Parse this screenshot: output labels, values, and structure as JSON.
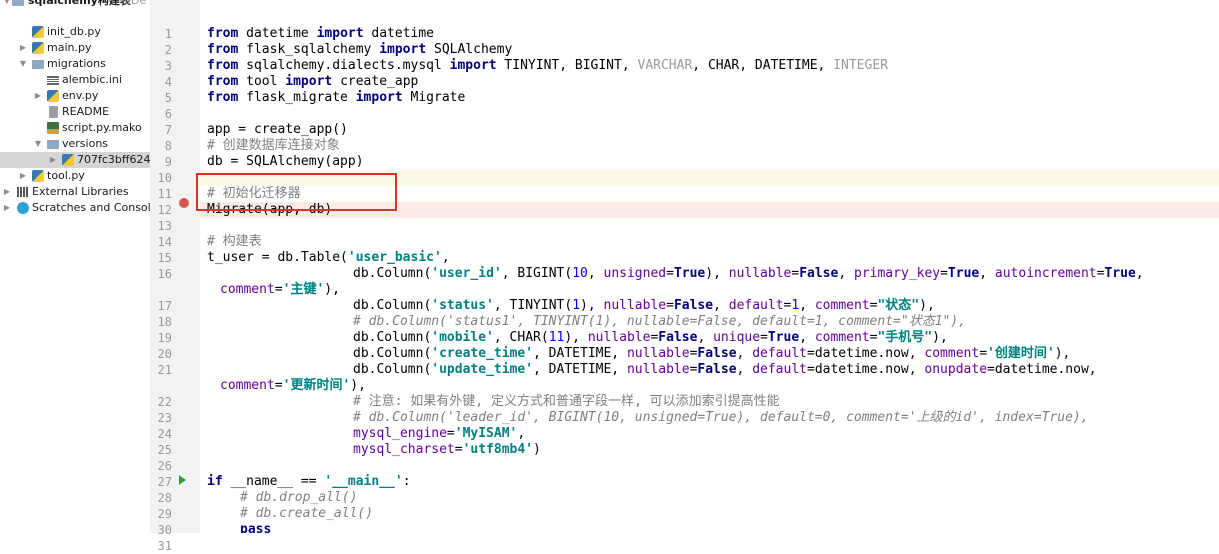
{
  "tree": {
    "project_partial": "sqlalchemy构建表",
    "project_path_partial": "~/De",
    "items": [
      {
        "label": "init_db.py",
        "icon": "python-file-icon"
      },
      {
        "label": "main.py",
        "icon": "python-file-icon"
      },
      {
        "label": "migrations",
        "icon": "folder-icon"
      },
      {
        "label": "alembic.ini",
        "icon": "ini-file-icon"
      },
      {
        "label": "env.py",
        "icon": "python-file-icon"
      },
      {
        "label": "README",
        "icon": "text-file-icon"
      },
      {
        "label": "script.py.mako",
        "icon": "mako-file-icon"
      },
      {
        "label": "versions",
        "icon": "folder-icon"
      },
      {
        "label": "707fc3bff624_",
        "icon": "python-file-icon"
      },
      {
        "label": "tool.py",
        "icon": "python-file-icon"
      },
      {
        "label": "External Libraries",
        "icon": "library-icon"
      },
      {
        "label": "Scratches and Consoles",
        "icon": "scratch-icon"
      }
    ]
  },
  "editor": {
    "line_numbers": [
      "1",
      "2",
      "3",
      "4",
      "5",
      "6",
      "7",
      "8",
      "9",
      "10",
      "11",
      "12",
      "13",
      "14",
      "15",
      "16",
      "17",
      "18",
      "19",
      "20",
      "21",
      "22",
      "23",
      "24",
      "25",
      "26",
      "27",
      "28",
      "29",
      "30",
      "31"
    ],
    "code": {
      "l1": [
        "from",
        " datetime ",
        "import",
        " datetime"
      ],
      "l2": [
        "from",
        " flask_sqlalchemy ",
        "import",
        " SQLAlchemy"
      ],
      "l3": [
        "from",
        " sqlalchemy.dialects.mysql ",
        "import",
        " TINYINT, BIGINT, ",
        "VARCHAR",
        ", CHAR, DATETIME, ",
        "INTEGER"
      ],
      "l4": [
        "from",
        " tool ",
        "import",
        " create_app"
      ],
      "l5": [
        "from",
        " flask_migrate ",
        "import",
        " Migrate"
      ],
      "l7": "app = create_app()",
      "l8": "# 创建数据库连接对象",
      "l9": "db = SQLAlchemy(app)",
      "l11": "# 初始化迁移器",
      "l12": "Migrate(app, db)",
      "l14": "# 构建表",
      "l15": [
        "t_user = db.Table(",
        "'user_basic'",
        ","
      ],
      "l16": [
        "db.Column(",
        "'user_id'",
        ", BIGINT(",
        "10",
        ", ",
        "unsigned",
        "=",
        "True",
        "), ",
        "nullable",
        "=",
        "False",
        ", ",
        "primary_key",
        "=",
        "True",
        ", ",
        "autoincrement",
        "=",
        "True",
        ","
      ],
      "l16b": [
        "comment",
        "=",
        "'主键'",
        "),"
      ],
      "l17": [
        "db.Column(",
        "'status'",
        ", TINYINT(",
        "1",
        "), ",
        "nullable",
        "=",
        "False",
        ", ",
        "default",
        "=",
        "1",
        ", ",
        "comment",
        "=",
        "\"状态\"",
        "),"
      ],
      "l18": "# db.Column('status1', TINYINT(1), nullable=False, default=1, comment=\"状态1\"),",
      "l19": [
        "db.Column(",
        "'mobile'",
        ", CHAR(",
        "11",
        "), ",
        "nullable",
        "=",
        "False",
        ", ",
        "unique",
        "=",
        "True",
        ", ",
        "comment",
        "=",
        "\"手机号\"",
        "),"
      ],
      "l20": [
        "db.Column(",
        "'create_time'",
        ", DATETIME, ",
        "nullable",
        "=",
        "False",
        ", ",
        "default",
        "=datetime.now, ",
        "comment",
        "=",
        "'创建时间'",
        "),"
      ],
      "l21": [
        "db.Column(",
        "'update_time'",
        ", DATETIME, ",
        "nullable",
        "=",
        "False",
        ", ",
        "default",
        "=datetime.now, ",
        "onupdate",
        "=datetime.now,"
      ],
      "l21b": [
        "comment",
        "=",
        "'更新时间'",
        "),"
      ],
      "l22": "# 注意: 如果有外键, 定义方式和普通字段一样, 可以添加索引提高性能",
      "l23": "# db.Column('leader_id', BIGINT(10, unsigned=True), default=0, comment='上级的id', index=True),",
      "l24": [
        "mysql_engine",
        "=",
        "'MyISAM'",
        ","
      ],
      "l25": [
        "mysql_charset",
        "=",
        "'utf8mb4'",
        ")"
      ],
      "l28": [
        "if",
        " __name__ == ",
        "'__main__'",
        ":"
      ],
      "l29": "# db.drop_all()",
      "l30": "# db.create_all()",
      "l31": "pass"
    }
  },
  "colors": {
    "keyword": "#000080",
    "string": "#008080",
    "number": "#0000ff",
    "param": "#660099",
    "comment": "#808080",
    "annotation_box": "#d9342b",
    "breakpoint": "#d9534f"
  }
}
